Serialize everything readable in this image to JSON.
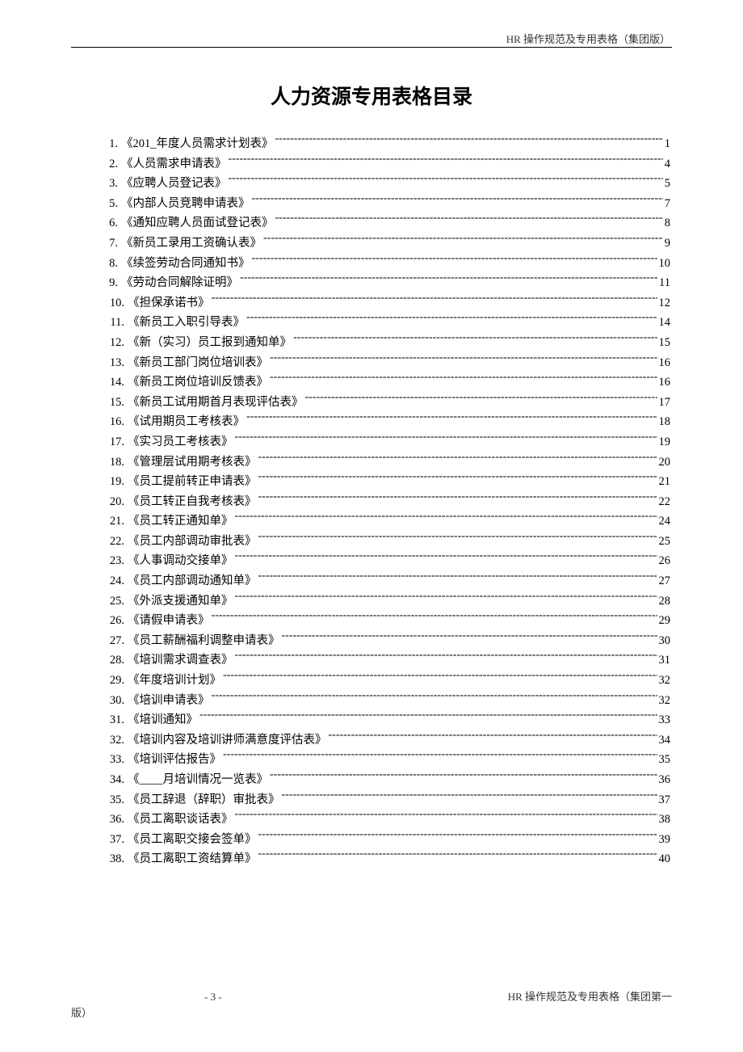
{
  "header": {
    "right": "HR 操作规范及专用表格（集团版）"
  },
  "title": "人力资源专用表格目录",
  "toc": [
    {
      "num": "1.",
      "label": "《201_年度人员需求计划表》",
      "page": "1"
    },
    {
      "num": "2.",
      "label": "《人员需求申请表》",
      "page": "4"
    },
    {
      "num": "3.",
      "label": "《应聘人员登记表》",
      "page": "5"
    },
    {
      "num": "5.",
      "label": "《内部人员竞聘申请表》",
      "page": "7"
    },
    {
      "num": "6.",
      "label": "《通知应聘人员面试登记表》",
      "page": "8"
    },
    {
      "num": "7.",
      "label": "《新员工录用工资确认表》",
      "page": "9"
    },
    {
      "num": "8.",
      "label": "《续签劳动合同通知书》",
      "page": "10"
    },
    {
      "num": "9.",
      "label": "《劳动合同解除证明》",
      "page": "11"
    },
    {
      "num": "10.",
      "label": "《担保承诺书》",
      "page": "12"
    },
    {
      "num": "11.",
      "label": "《新员工入职引导表》",
      "page": "14"
    },
    {
      "num": "12.",
      "label": "《新（实习）员工报到通知单》",
      "page": "15"
    },
    {
      "num": "13.",
      "label": "《新员工部门岗位培训表》",
      "page": "16"
    },
    {
      "num": "14.",
      "label": "《新员工岗位培训反馈表》",
      "page": "16"
    },
    {
      "num": "15.",
      "label": "《新员工试用期首月表现评估表》",
      "page": "17"
    },
    {
      "num": "16.",
      "label": "《试用期员工考核表》",
      "page": "18"
    },
    {
      "num": "17.",
      "label": "《实习员工考核表》",
      "page": "19"
    },
    {
      "num": "18.",
      "label": "《管理层试用期考核表》",
      "page": "20"
    },
    {
      "num": "19.",
      "label": "《员工提前转正申请表》",
      "page": "21"
    },
    {
      "num": "20.",
      "label": "《员工转正自我考核表》",
      "page": "22"
    },
    {
      "num": "21.",
      "label": "《员工转正通知单》",
      "page": "24"
    },
    {
      "num": "22.",
      "label": "《员工内部调动审批表》",
      "page": "25"
    },
    {
      "num": "23.",
      "label": "《人事调动交接单》",
      "page": "26"
    },
    {
      "num": "24.",
      "label": "《员工内部调动通知单》",
      "page": "27"
    },
    {
      "num": "25.",
      "label": "《外派支援通知单》",
      "page": "28"
    },
    {
      "num": "26.",
      "label": "《请假申请表》",
      "page": "29"
    },
    {
      "num": "27.",
      "label": "《员工薪酬福利调整申请表》",
      "page": "30"
    },
    {
      "num": "28.",
      "label": "《培训需求调查表》",
      "page": "31"
    },
    {
      "num": "29.",
      "label": "《年度培训计划》",
      "page": "32"
    },
    {
      "num": "30.",
      "label": "《培训申请表》",
      "page": "32"
    },
    {
      "num": "31.",
      "label": "《培训通知》",
      "page": "33"
    },
    {
      "num": "32.",
      "label": "《培训内容及培训讲师满意度评估表》",
      "page": "34"
    },
    {
      "num": "33.",
      "label": "《培训评估报告》",
      "page": "35"
    },
    {
      "num": "34.",
      "label": "《____月培训情况一览表》",
      "page": "36"
    },
    {
      "num": "35.",
      "label": "《员工辞退（辞职）审批表》",
      "page": "37"
    },
    {
      "num": "36.",
      "label": "《员工离职谈话表》",
      "page": "38"
    },
    {
      "num": "37.",
      "label": "《员工离职交接会签单》",
      "page": "39"
    },
    {
      "num": "38.",
      "label": "《员工离职工资结算单》",
      "page": "40"
    }
  ],
  "footer": {
    "page": "- 3 -",
    "right": "HR 操作规范及专用表格（集团第一",
    "below": "版）"
  }
}
